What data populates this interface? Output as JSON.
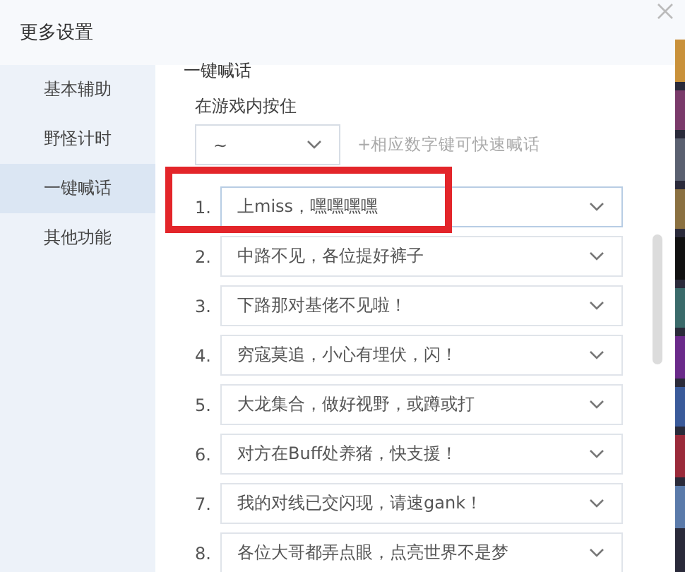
{
  "window": {
    "title": "更多设置"
  },
  "sidebar": {
    "items": [
      {
        "label": "基本辅助",
        "selected": false
      },
      {
        "label": "野怪计时",
        "selected": false
      },
      {
        "label": "一键喊话",
        "selected": true
      },
      {
        "label": "其他功能",
        "selected": false
      }
    ]
  },
  "section": {
    "title": "一键喊话",
    "key_label": "在游戏内按住",
    "key_select": {
      "value": "~"
    },
    "hint": "+相应数字键可快速喊话"
  },
  "phrases": [
    {
      "number": "1.",
      "text": "上miss，嘿嘿嘿嘿"
    },
    {
      "number": "2.",
      "text": "中路不见，各位提好裤子"
    },
    {
      "number": "3.",
      "text": "下路那对基佬不见啦！"
    },
    {
      "number": "4.",
      "text": "穷寇莫追，小心有埋伏，闪！"
    },
    {
      "number": "5.",
      "text": "大龙集合，做好视野，或蹲或打"
    },
    {
      "number": "6.",
      "text": "对方在Buff处养猪，快支援！"
    },
    {
      "number": "7.",
      "text": "我的对线已交闪现，请速gank！"
    },
    {
      "number": "8.",
      "text": "各位大哥都弄点眼，点亮世界不是梦"
    }
  ]
}
